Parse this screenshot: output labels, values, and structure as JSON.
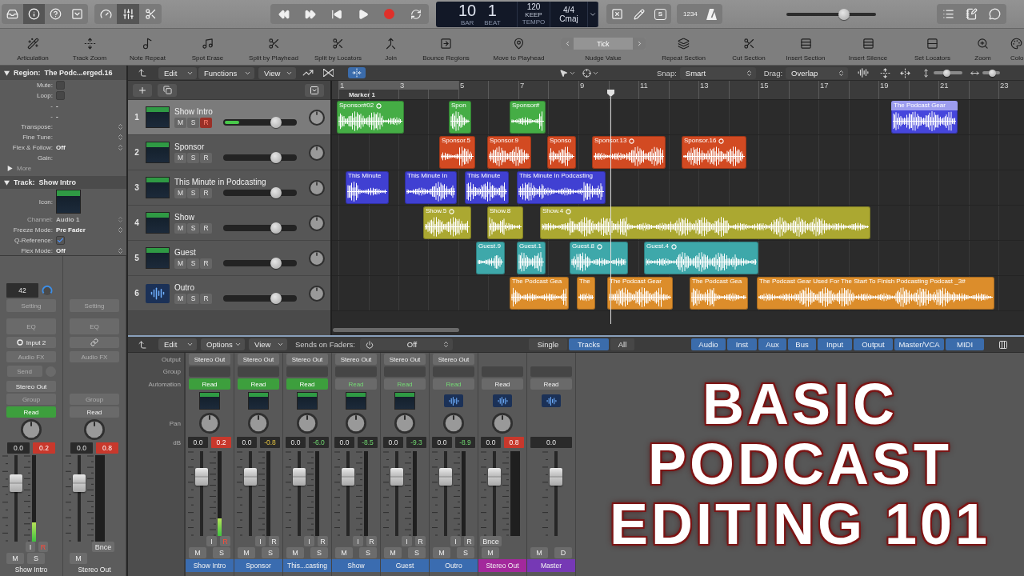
{
  "control_bar": {
    "view_buttons": [
      {
        "selected": false
      },
      {
        "selected": true
      },
      {
        "selected": false
      },
      {
        "selected": false
      }
    ],
    "tool_buttons": [
      {
        "selected": false
      },
      {
        "selected": true
      },
      {
        "selected": false
      }
    ],
    "lcd": {
      "bar": "10",
      "bar_label": "BAR",
      "beat": "1",
      "beat_label": "BEAT",
      "tempo": "120",
      "tempo_mode": "KEEP",
      "tempo_label": "TEMPO",
      "time_signature": "4/4",
      "key": "Cmaj"
    },
    "editor_letter": "S",
    "count_in": "1234",
    "master_volume": {
      "level": 0.67
    }
  },
  "toolbar": {
    "items": [
      {
        "kind": "button",
        "label": "Articulation"
      },
      {
        "kind": "button",
        "label": "Track Zoom"
      },
      {
        "kind": "button",
        "label": "Note Repeat"
      },
      {
        "kind": "button",
        "label": "Spot Erase"
      },
      {
        "kind": "button",
        "label": "Split by Playhead"
      },
      {
        "kind": "button",
        "label": "Split by Locators"
      },
      {
        "kind": "button",
        "label": "Join"
      },
      {
        "kind": "button",
        "label": "Bounce Regions"
      },
      {
        "kind": "button",
        "label": "Move to Playhead"
      },
      {
        "kind": "stepper",
        "label": "Nudge Value",
        "value": "Tick"
      },
      {
        "kind": "button",
        "label": "Repeat Section"
      },
      {
        "kind": "button",
        "label": "Cut Section"
      },
      {
        "kind": "button",
        "label": "Insert Section"
      },
      {
        "kind": "button",
        "label": "Insert Silence"
      },
      {
        "kind": "button",
        "label": "Set Locators"
      },
      {
        "kind": "button",
        "label": "Zoom"
      },
      {
        "kind": "button",
        "label": "Colo"
      }
    ]
  },
  "inspector": {
    "region": {
      "expanded": true,
      "label": "Region:",
      "name": "The Podc...erged.16",
      "fields": [
        {
          "kind": "checkbox",
          "label": "Mute:",
          "checked": false
        },
        {
          "kind": "checkbox",
          "label": "Loop:",
          "checked": false
        },
        {
          "kind": "dash",
          "label": "-",
          "value": "-"
        },
        {
          "kind": "dash",
          "label": "-",
          "value": "-"
        },
        {
          "kind": "stepper",
          "label": "Transpose:"
        },
        {
          "kind": "stepper",
          "label": "Fine Tune:"
        },
        {
          "kind": "stepper",
          "label": "Flex & Follow:",
          "value": "Off"
        },
        {
          "kind": "text",
          "label": "Gain:"
        }
      ],
      "more": {
        "label": "More",
        "expanded": false
      }
    },
    "track": {
      "expanded": true,
      "label": "Track:",
      "name": "Show Intro",
      "fields": [
        {
          "kind": "icon",
          "label": "Icon:",
          "disabled": false
        },
        {
          "kind": "stepper",
          "label": "Channel:",
          "value": "Audio 1",
          "disabled": true
        },
        {
          "kind": "stepper",
          "label": "Freeze Mode:",
          "value": "Pre Fader",
          "disabled": false
        },
        {
          "kind": "checkbox",
          "label": "Q-Reference:",
          "checked": true,
          "disabled": false
        },
        {
          "kind": "stepper",
          "label": "Flex Mode:",
          "value": "Off",
          "disabled": false
        }
      ]
    }
  },
  "inspector_strips": [
    {
      "name": "Show Intro",
      "gain": "42",
      "setting": "Setting",
      "eq": "EQ",
      "input": {
        "kind": "input",
        "label": "Input 2"
      },
      "audio_fx": "Audio FX",
      "send": "Send",
      "output": "Stereo Out",
      "group": "Group",
      "automation": {
        "kind": "active",
        "label": "Read"
      },
      "volume": "0.0",
      "peak": {
        "kind": "clip",
        "value": "0.2"
      },
      "fader": {
        "level": 0.72
      },
      "meter": {
        "level": 0.22
      },
      "arm_buttons": [
        {
          "label": "I",
          "on": false
        },
        {
          "label": "R",
          "on": true
        }
      ],
      "mute_solo": [
        {
          "label": "M"
        },
        {
          "label": "S"
        }
      ]
    },
    {
      "name": "Stereo Out",
      "setting": "Setting",
      "eq": "EQ",
      "input": {
        "kind": "link"
      },
      "audio_fx": "Audio FX",
      "group": "Group",
      "automation": {
        "kind": "off",
        "label": "Read"
      },
      "volume": "0.0",
      "peak": {
        "kind": "clip",
        "value": "0.8"
      },
      "fader": {
        "level": 0.72
      },
      "arm_buttons": [
        {
          "label": "Bnce",
          "on": false
        }
      ],
      "mute_solo": [
        {
          "label": "M"
        }
      ]
    }
  ],
  "tracks": {
    "menus": [
      {
        "label": "Edit"
      },
      {
        "label": "Functions"
      },
      {
        "label": "View"
      }
    ],
    "flex_button": {
      "selected": true
    },
    "snap": {
      "label": "Snap:",
      "value": "Smart"
    },
    "drag": {
      "label": "Drag:",
      "value": "Overlap"
    },
    "zoom_sliders": [
      {
        "level": 0.45
      },
      {
        "level": 0.6
      }
    ],
    "ruler": {
      "bars": [
        "1",
        "3",
        "5",
        "7",
        "9",
        "11",
        "13",
        "15",
        "17",
        "19",
        "21",
        "23"
      ],
      "marker": "Marker 1"
    },
    "list": [
      {
        "number": "1",
        "name": "Show Intro",
        "selected": true,
        "icon": {
          "kind": "image"
        },
        "buttons": [
          {
            "label": "M",
            "on": false
          },
          {
            "label": "S",
            "on": false
          },
          {
            "label": "R",
            "on": true
          }
        ],
        "volume": {
          "level": 0.75
        },
        "meter": {
          "level": 0.21
        },
        "regions": [
          {
            "name": "Sponsor#02",
            "color": "#45ad45",
            "selected": false,
            "ring": true
          },
          {
            "name": "Spon",
            "color": "#45ad45",
            "selected": false,
            "ring": false
          },
          {
            "name": "Sponsor#",
            "color": "#45ad45",
            "selected": false,
            "ring": false
          },
          {
            "name": "The Podcast Gear",
            "color": "#4646dc",
            "selected": true,
            "ring": false
          }
        ]
      },
      {
        "number": "2",
        "name": "Sponsor",
        "selected": false,
        "icon": {
          "kind": "image"
        },
        "buttons": [
          {
            "label": "M",
            "on": false
          },
          {
            "label": "S",
            "on": false
          },
          {
            "label": "R",
            "on": false
          }
        ],
        "volume": {
          "level": 0.75
        },
        "regions": [
          {
            "name": "Sponsor.5",
            "color": "#d24a22",
            "selected": false,
            "ring": false
          },
          {
            "name": "Sponsor.9",
            "color": "#d24a22",
            "selected": false,
            "ring": false
          },
          {
            "name": "Sponso",
            "color": "#d24a22",
            "selected": false,
            "ring": false
          },
          {
            "name": "Sponsor.13",
            "color": "#d24a22",
            "selected": false,
            "ring": true
          },
          {
            "name": "Sponsor.16",
            "color": "#d24a22",
            "selected": false,
            "ring": true
          }
        ]
      },
      {
        "number": "3",
        "name": "This Minute in Podcasting",
        "selected": false,
        "icon": {
          "kind": "image"
        },
        "buttons": [
          {
            "label": "M",
            "on": false
          },
          {
            "label": "S",
            "on": false
          },
          {
            "label": "R",
            "on": false
          }
        ],
        "volume": {
          "level": 0.75
        },
        "regions": [
          {
            "name": "This Minute",
            "color": "#4040d2",
            "selected": false,
            "ring": false
          },
          {
            "name": "This Minute In",
            "color": "#4040d2",
            "selected": false,
            "ring": false
          },
          {
            "name": "This Minute",
            "color": "#4040d2",
            "selected": false,
            "ring": false
          },
          {
            "name": "This Minute In Podcasting",
            "color": "#4040d2",
            "selected": false,
            "ring": false
          }
        ]
      },
      {
        "number": "4",
        "name": "Show",
        "selected": false,
        "icon": {
          "kind": "image"
        },
        "buttons": [
          {
            "label": "M",
            "on": false
          },
          {
            "label": "S",
            "on": false
          },
          {
            "label": "R",
            "on": false
          }
        ],
        "volume": {
          "level": 0.75
        },
        "regions": [
          {
            "name": "Show.5",
            "color": "#aba831",
            "selected": false,
            "ring": true
          },
          {
            "name": "Show.8",
            "color": "#aba831",
            "selected": false,
            "ring": false
          },
          {
            "name": "Show.4",
            "color": "#aba831",
            "selected": false,
            "ring": true
          }
        ]
      },
      {
        "number": "5",
        "name": "Guest",
        "selected": false,
        "icon": {
          "kind": "image"
        },
        "buttons": [
          {
            "label": "M",
            "on": false
          },
          {
            "label": "S",
            "on": false
          },
          {
            "label": "R",
            "on": false
          }
        ],
        "volume": {
          "level": 0.75
        },
        "regions": [
          {
            "name": "Guest.9",
            "color": "#3ea8aa",
            "selected": false,
            "ring": false
          },
          {
            "name": "Guest.1",
            "color": "#3ea8aa",
            "selected": false,
            "ring": false
          },
          {
            "name": "Guest.8",
            "color": "#3ea8aa",
            "selected": false,
            "ring": true
          },
          {
            "name": "Guest.4",
            "color": "#3ea8aa",
            "selected": false,
            "ring": true
          }
        ]
      },
      {
        "number": "6",
        "name": "Outro",
        "selected": false,
        "icon": {
          "kind": "wave"
        },
        "buttons": [
          {
            "label": "M",
            "on": false
          },
          {
            "label": "S",
            "on": false
          },
          {
            "label": "R",
            "on": false
          }
        ],
        "volume": {
          "level": 0.75
        },
        "regions": [
          {
            "name": "The Podcast Gea",
            "color": "#dc8d2b",
            "selected": false,
            "ring": false
          },
          {
            "name": "The",
            "color": "#dc8d2b",
            "selected": false,
            "ring": false
          },
          {
            "name": "The Podcast Gear",
            "color": "#dc8d2b",
            "selected": false,
            "ring": false
          },
          {
            "name": "The Podcast Gea",
            "color": "#dc8d2b",
            "selected": false,
            "ring": false
          },
          {
            "name": "The Podcast Gear Used For The Start To Finish Podcasting Podcast _3#",
            "color": "#dc8d2b",
            "selected": false,
            "ring": false
          }
        ]
      }
    ]
  },
  "mixer": {
    "menus": [
      {
        "label": "Edit"
      },
      {
        "label": "Options"
      },
      {
        "label": "View"
      }
    ],
    "sends": {
      "label": "Sends on Faders:",
      "value": "Off"
    },
    "view_modes": [
      {
        "label": "Single",
        "selected": false
      },
      {
        "label": "Tracks",
        "selected": true
      },
      {
        "label": "All",
        "selected": false
      }
    ],
    "filters": [
      {
        "label": "Audio",
        "on": true
      },
      {
        "label": "Inst",
        "on": true
      },
      {
        "label": "Aux",
        "on": true
      },
      {
        "label": "Bus",
        "on": true
      },
      {
        "label": "Input",
        "on": true
      },
      {
        "label": "Output",
        "on": true
      },
      {
        "label": "Master/VCA",
        "on": true
      },
      {
        "label": "MIDI",
        "on": true
      }
    ],
    "row_labels": {
      "output": "Output",
      "group": "Group",
      "automation": "Automation",
      "pan": "Pan",
      "db": "dB"
    },
    "strips": [
      {
        "name": "Show Intro",
        "color": "#3a6cb0",
        "kind": "track",
        "icon": {
          "kind": "image"
        },
        "output": "Stereo Out",
        "automation": {
          "kind": "active",
          "label": "Read"
        },
        "volume": "0.0",
        "peak": {
          "kind": "clip",
          "value": "0.2"
        },
        "fader": {
          "level": 0.75
        },
        "meter": {
          "level": 0.21
        },
        "arm_buttons": [
          {
            "label": "I",
            "on": false
          },
          {
            "label": "R",
            "on": true
          }
        ],
        "mute_solo": [
          {
            "label": "M"
          },
          {
            "label": "S"
          }
        ]
      },
      {
        "name": "Sponsor",
        "color": "#3a6cb0",
        "kind": "track",
        "icon": {
          "kind": "image"
        },
        "output": "Stereo Out",
        "automation": {
          "kind": "active",
          "label": "Read"
        },
        "volume": "0.0",
        "peak": {
          "kind": "hot",
          "value": "-0.8"
        },
        "fader": {
          "level": 0.75
        },
        "arm_buttons": [
          {
            "label": "I",
            "on": false
          },
          {
            "label": "R",
            "on": false
          }
        ],
        "mute_solo": [
          {
            "label": "M"
          },
          {
            "label": "S"
          }
        ]
      },
      {
        "name": "This...casting",
        "color": "#3a6cb0",
        "kind": "track",
        "icon": {
          "kind": "image"
        },
        "output": "Stereo Out",
        "automation": {
          "kind": "active",
          "label": "Read"
        },
        "volume": "0.0",
        "peak": {
          "kind": "normal",
          "value": "-6.0"
        },
        "fader": {
          "level": 0.75
        },
        "arm_buttons": [
          {
            "label": "I",
            "on": false
          },
          {
            "label": "R",
            "on": false
          }
        ],
        "mute_solo": [
          {
            "label": "M"
          },
          {
            "label": "S"
          }
        ]
      },
      {
        "name": "Show",
        "color": "#3a6cb0",
        "kind": "track",
        "icon": {
          "kind": "image"
        },
        "output": "Stereo Out",
        "automation": {
          "kind": "standby",
          "label": "Read"
        },
        "volume": "0.0",
        "peak": {
          "kind": "normal",
          "value": "-8.5"
        },
        "fader": {
          "level": 0.75
        },
        "arm_buttons": [
          {
            "label": "I",
            "on": false
          },
          {
            "label": "R",
            "on": false
          }
        ],
        "mute_solo": [
          {
            "label": "M"
          },
          {
            "label": "S"
          }
        ]
      },
      {
        "name": "Guest",
        "color": "#3a6cb0",
        "kind": "track",
        "icon": {
          "kind": "image"
        },
        "output": "Stereo Out",
        "automation": {
          "kind": "standby",
          "label": "Read"
        },
        "volume": "0.0",
        "peak": {
          "kind": "normal",
          "value": "-9.3"
        },
        "fader": {
          "level": 0.75
        },
        "arm_buttons": [
          {
            "label": "I",
            "on": false
          },
          {
            "label": "R",
            "on": false
          }
        ],
        "mute_solo": [
          {
            "label": "M"
          },
          {
            "label": "S"
          }
        ]
      },
      {
        "name": "Outro",
        "color": "#3a6cb0",
        "kind": "track",
        "icon": {
          "kind": "wave"
        },
        "output": "Stereo Out",
        "automation": {
          "kind": "standby",
          "label": "Read"
        },
        "volume": "0.0",
        "peak": {
          "kind": "normal",
          "value": "-8.9"
        },
        "fader": {
          "level": 0.75
        },
        "arm_buttons": [
          {
            "label": "I",
            "on": false
          },
          {
            "label": "R",
            "on": false
          }
        ],
        "mute_solo": [
          {
            "label": "M"
          },
          {
            "label": "S"
          }
        ]
      },
      {
        "name": "Stereo Out",
        "color": "#a3289c",
        "kind": "output",
        "icon": {
          "kind": "wave"
        },
        "automation": {
          "kind": "off",
          "label": "Read"
        },
        "volume": "0.0",
        "peak": {
          "kind": "clip",
          "value": "0.8"
        },
        "fader": {
          "level": 0.75
        },
        "arm_buttons": [
          {
            "label": "Bnce",
            "on": false
          }
        ],
        "mute_solo": [
          {
            "label": "M"
          }
        ]
      },
      {
        "name": "Master",
        "color": "#7639b5",
        "kind": "master",
        "icon": {
          "kind": "wave"
        },
        "automation": {
          "kind": "off",
          "label": "Read"
        },
        "volume": "0.0",
        "fader": {
          "level": 0.75
        },
        "mute_solo": [
          {
            "label": "M"
          },
          {
            "label": "D"
          }
        ]
      }
    ]
  },
  "overlay_title": {
    "lines": [
      "BASIC",
      "PODCAST",
      "EDITING 101"
    ]
  }
}
